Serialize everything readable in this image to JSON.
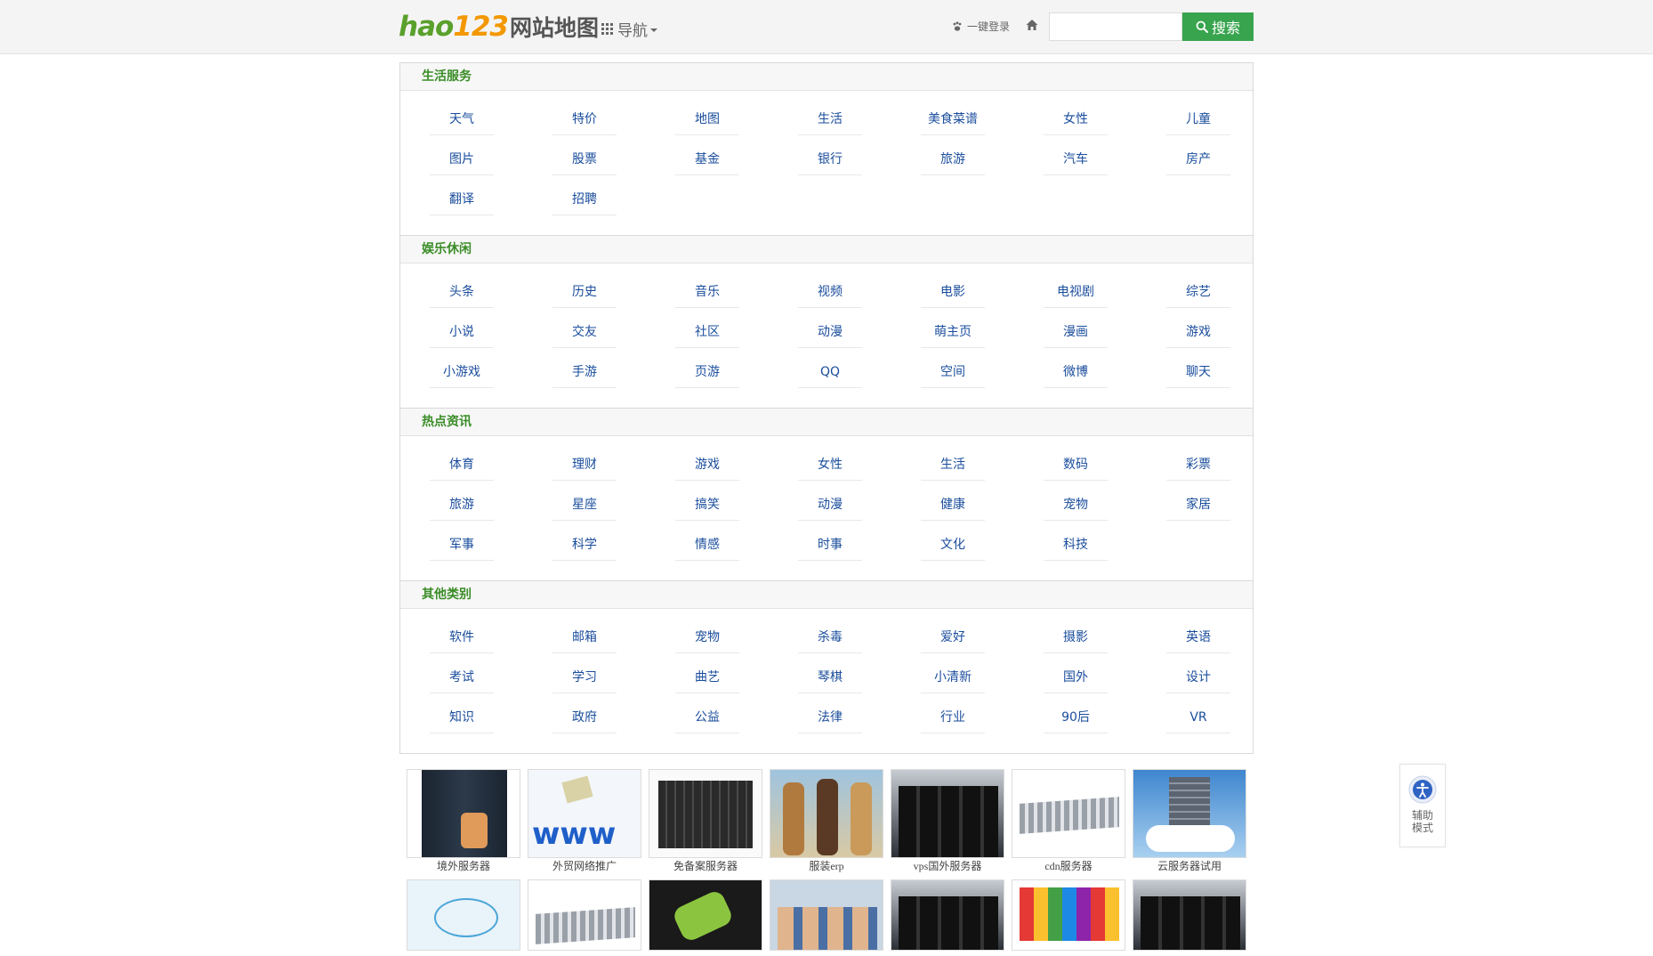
{
  "header": {
    "logo_mark": [
      "h",
      "ao",
      "123"
    ],
    "logo_text": "网站地图",
    "nav_label": "导航",
    "login_label": "一键登录",
    "search_placeholder": "",
    "search_button": "搜索",
    "brand_green": "#5aa02c",
    "brand_orange": "#f39800",
    "search_btn_color": "#38a44e"
  },
  "sections": [
    {
      "title": "生活服务",
      "links": [
        "天气",
        "特价",
        "地图",
        "生活",
        "美食菜谱",
        "女性",
        "儿童",
        "图片",
        "股票",
        "基金",
        "银行",
        "旅游",
        "汽车",
        "房产",
        "翻译",
        "招聘"
      ]
    },
    {
      "title": "娱乐休闲",
      "links": [
        "头条",
        "历史",
        "音乐",
        "视频",
        "电影",
        "电视剧",
        "综艺",
        "小说",
        "交友",
        "社区",
        "动漫",
        "萌主页",
        "漫画",
        "游戏",
        "小游戏",
        "手游",
        "页游",
        "QQ",
        "空间",
        "微博",
        "聊天"
      ]
    },
    {
      "title": "热点资讯",
      "links": [
        "体育",
        "理财",
        "游戏",
        "女性",
        "生活",
        "数码",
        "彩票",
        "旅游",
        "星座",
        "搞笑",
        "动漫",
        "健康",
        "宠物",
        "家居",
        "军事",
        "科学",
        "情感",
        "时事",
        "文化",
        "科技"
      ]
    },
    {
      "title": "其他类别",
      "links": [
        "软件",
        "邮箱",
        "宠物",
        "杀毒",
        "爱好",
        "摄影",
        "英语",
        "考试",
        "学习",
        "曲艺",
        "琴棋",
        "小清新",
        "国外",
        "设计",
        "知识",
        "政府",
        "公益",
        "法律",
        "行业",
        "90后",
        "VR"
      ]
    }
  ],
  "thumbnails": {
    "row1": [
      {
        "caption": "境外服务器",
        "icon": "server-technician-photo"
      },
      {
        "caption": "外贸网络推广",
        "icon": "www-figure-photo"
      },
      {
        "caption": "免备案服务器",
        "icon": "blade-server-photo"
      },
      {
        "caption": "服装erp",
        "icon": "fashion-models-photo"
      },
      {
        "caption": "vps国外服务器",
        "icon": "server-room-photo"
      },
      {
        "caption": "cdn服务器",
        "icon": "server-rack-photo"
      },
      {
        "caption": "云服务器试用",
        "icon": "cloud-server-photo"
      }
    ],
    "row2": [
      {
        "icon": "network-diagram-photo"
      },
      {
        "icon": "storage-server-photo"
      },
      {
        "icon": "cleaning-hand-photo"
      },
      {
        "icon": "group-people-photo"
      },
      {
        "icon": "datacenter-aisle-photo"
      },
      {
        "icon": "colorful-figures-photo"
      },
      {
        "icon": "server-cabinet-photo"
      }
    ]
  },
  "assist": {
    "label": "辅助模式"
  },
  "colors": {
    "link": "#1a4d9c",
    "section_title": "#3a8c27"
  }
}
